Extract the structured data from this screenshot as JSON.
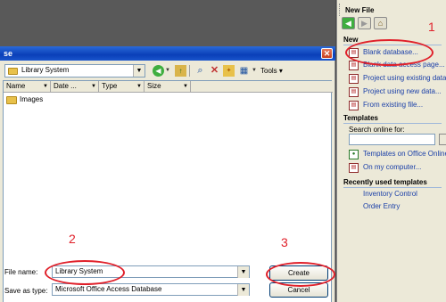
{
  "dialog": {
    "title": "se",
    "close_glyph": "✕",
    "look_in": "Library System",
    "tools_label": "Tools",
    "columns": [
      "Name",
      "Date ...",
      "Type",
      "Size"
    ],
    "items": [
      {
        "name": "Images"
      }
    ],
    "file_name_label": "File name:",
    "file_name_value": "Library System",
    "save_type_label": "Save as type:",
    "save_type_value": "Microsoft Office Access Database",
    "create_label": "Create",
    "cancel_label": "Cancel"
  },
  "task_pane": {
    "title": "New File",
    "new_section": "New",
    "new_items": [
      "Blank database...",
      "Blank data access page...",
      "Project using existing data...",
      "Project using new data...",
      "From existing file..."
    ],
    "templates_section": "Templates",
    "search_label": "Search online for:",
    "template_links": [
      "Templates on Office Online",
      "On my computer..."
    ],
    "recent_section": "Recently used templates",
    "recent_items": [
      "Inventory Control",
      "Order Entry"
    ]
  },
  "annotations": [
    "1",
    "2",
    "3"
  ],
  "colors": {
    "annotation": "#e0202a",
    "titlebar": "#0a3fb8",
    "link": "#1a3fa8"
  }
}
